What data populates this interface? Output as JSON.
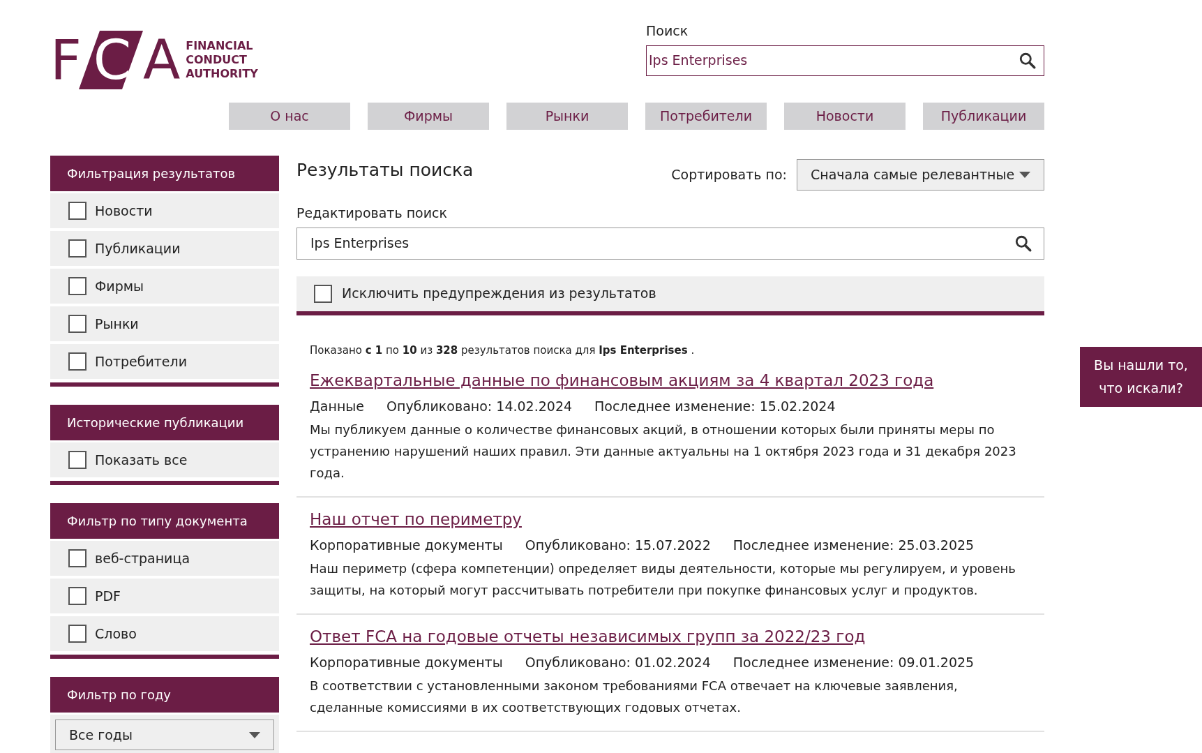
{
  "logo": {
    "mark": "FCA",
    "lines": [
      "FINANCIAL",
      "CONDUCT",
      "AUTHORITY"
    ]
  },
  "search": {
    "label": "Поиск",
    "value": "Ips Enterprises"
  },
  "nav": [
    "О нас",
    "Фирмы",
    "Рынки",
    "Потребители",
    "Новости",
    "Публикации"
  ],
  "sidebar": [
    {
      "title": "Фильтрация результатов",
      "kind": "checkboxes",
      "items": [
        {
          "label": "Новости",
          "checked": false
        },
        {
          "label": "Публикации",
          "checked": false
        },
        {
          "label": "Фирмы",
          "checked": false
        },
        {
          "label": "Рынки",
          "checked": false
        },
        {
          "label": "Потребители",
          "checked": false
        }
      ]
    },
    {
      "title": "Исторические публикации",
      "kind": "checkboxes",
      "items": [
        {
          "label": "Показать все",
          "checked": false
        }
      ]
    },
    {
      "title": "Фильтр по типу документа",
      "kind": "checkboxes",
      "items": [
        {
          "label": "веб-страница",
          "checked": false
        },
        {
          "label": "PDF",
          "checked": false
        },
        {
          "label": "Слово",
          "checked": false
        }
      ]
    },
    {
      "title": "Фильтр по году",
      "kind": "select",
      "value": "Все годы"
    }
  ],
  "results_title": "Результаты поиска",
  "sort": {
    "label": "Сортировать по:",
    "value": "Сначала самые релевантные"
  },
  "edit_search": {
    "label": "Редактировать поиск",
    "value": "Ips Enterprises"
  },
  "exclude_warnings": {
    "label": "Исключить предупреждения из результатов",
    "checked": false
  },
  "summary": "Показано **с 1** по **10** из **328** результатов поиска для **Ips Enterprises** .",
  "results": [
    {
      "title": "Ежеквартальные данные по финансовым акциям за 4 квартал 2023 года",
      "type": "Данные",
      "published": "Опубликовано: 14.02.2024",
      "modified": "Последнее изменение: 15.02.2024",
      "description": "Мы публикуем данные о количестве финансовых акций, в отношении которых были приняты меры по устранению нарушений наших правил. Эти данные актуальны на 1 октября 2023 года и 31 декабря 2023 года."
    },
    {
      "title": "Наш отчет по периметру",
      "type": "Корпоративные документы",
      "published": "Опубликовано: 15.07.2022",
      "modified": "Последнее изменение: 25.03.2025",
      "description": "Наш периметр (сфера компетенции) определяет виды деятельности, которые мы регулируем, и уровень защиты, на который могут рассчитывать потребители при покупке финансовых услуг и продуктов."
    },
    {
      "title": "Ответ FCA на годовые отчеты независимых групп за 2022/23 год",
      "type": "Корпоративные документы",
      "published": "Опубликовано: 01.02.2024",
      "modified": "Последнее изменение: 09.01.2025",
      "description": "В соответствии с установленными законом требованиями FCA отвечает на ключевые заявления, сделанные комиссиями в их соответствующих годовых отчетах."
    }
  ],
  "feedback": "Вы нашли то, что искали?"
}
